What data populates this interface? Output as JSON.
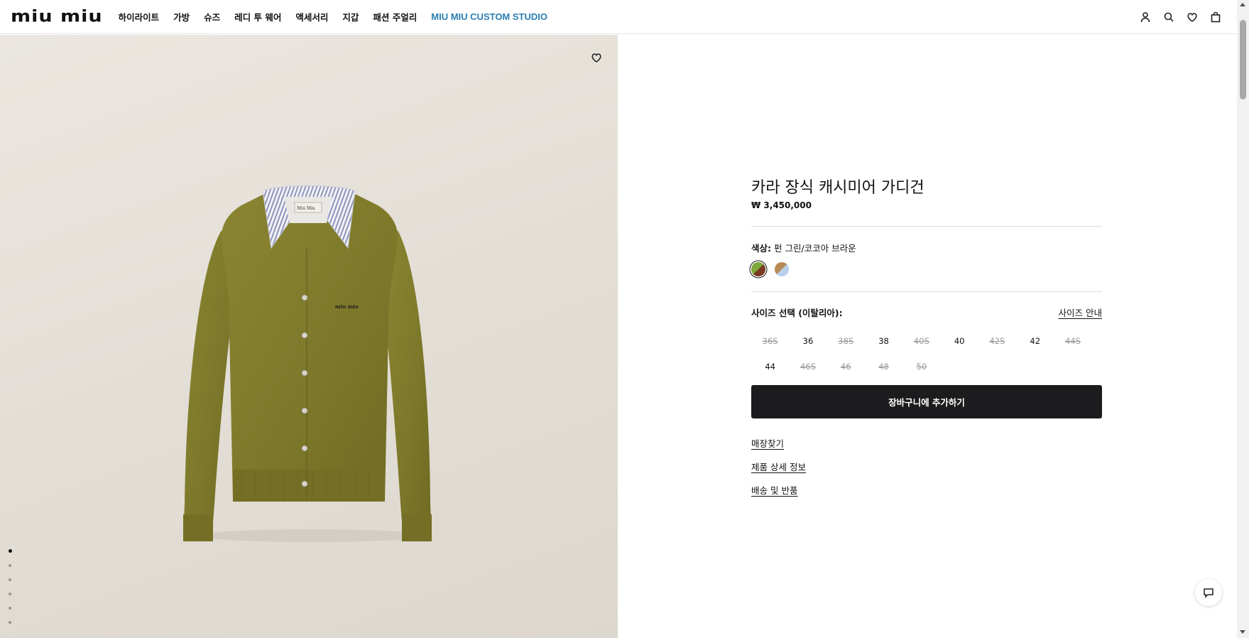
{
  "brand": {
    "logo_text": "miu miu"
  },
  "nav": {
    "items": [
      {
        "label": "하이라이트"
      },
      {
        "label": "가방"
      },
      {
        "label": "슈즈"
      },
      {
        "label": "레디 투 웨어"
      },
      {
        "label": "액세서리"
      },
      {
        "label": "지갑"
      },
      {
        "label": "패션 주얼리"
      },
      {
        "label": "MIU MIU CUSTOM STUDIO",
        "accent": "#2b7fb4"
      }
    ],
    "icons": [
      "account-icon",
      "search-icon",
      "heart-icon",
      "shopping-bag-icon"
    ]
  },
  "gallery": {
    "image_count": 6,
    "active_index": 0,
    "wishlist_icon": "heart-icon",
    "product_colors": {
      "knit": "#7f7a2b",
      "collar_stripe": "#9aa0c4",
      "background": "#e6e1da"
    },
    "garment_label": "Miu Miu"
  },
  "product": {
    "title": "카라 장식 캐시미어 가디건",
    "price": "₩ 3,450,000",
    "color_label": "색상:",
    "color_value": "펀 그린/코코아 브라운",
    "swatches": [
      {
        "name": "펀 그린/코코아 브라운",
        "colors": [
          "#7ea83a",
          "#7a3a22"
        ],
        "selected": true
      },
      {
        "name": "swatch-2",
        "colors": [
          "#b58a55",
          "#b8d0ea"
        ],
        "selected": false
      }
    ],
    "size_label": "사이즈 선택 (이탈리아):",
    "size_guide": "사이즈 안내",
    "sizes": [
      {
        "label": "36S",
        "available": false
      },
      {
        "label": "36",
        "available": true
      },
      {
        "label": "38S",
        "available": false
      },
      {
        "label": "38",
        "available": true
      },
      {
        "label": "40S",
        "available": false
      },
      {
        "label": "40",
        "available": true
      },
      {
        "label": "42S",
        "available": false
      },
      {
        "label": "42",
        "available": true
      },
      {
        "label": "44S",
        "available": false
      },
      {
        "label": "44",
        "available": true
      },
      {
        "label": "46S",
        "available": false
      },
      {
        "label": "46",
        "available": false
      },
      {
        "label": "48",
        "available": false
      },
      {
        "label": "50",
        "available": false
      }
    ],
    "add_to_cart": "장바구니에 추가하기",
    "links": [
      "매장찾기",
      "제품 상세 정보",
      "배송 및 반품"
    ]
  },
  "chat": {
    "icon": "chat-icon"
  }
}
